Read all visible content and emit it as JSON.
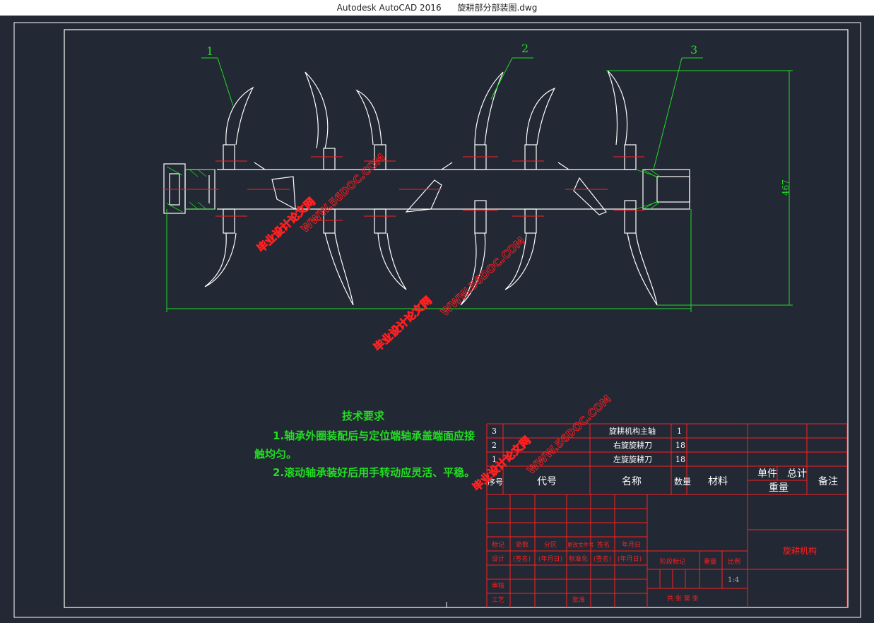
{
  "window": {
    "app": "Autodesk AutoCAD 2016",
    "file": "旋耕部分部装图.dwg"
  },
  "drawing": {
    "balloons": [
      "1",
      "2",
      "3"
    ],
    "dim_height": "467",
    "tech_title": "技术要求",
    "tech_line1": "1.轴承外圈装配后与定位端轴承盖端面应接",
    "tech_line2": "触均匀。",
    "tech_line3": "2.滚动轴承装好后用手转动应灵活、平稳。",
    "watermark_url": "WWW.56DOC.COM",
    "watermark_cn": "毕业设计论文网"
  },
  "bom": {
    "rows": [
      {
        "no": "3",
        "name": "旋耕机构主轴",
        "qty": "1"
      },
      {
        "no": "2",
        "name": "右旋旋耕刀",
        "qty": "18"
      },
      {
        "no": "1",
        "name": "左旋旋耕刀",
        "qty": "18"
      }
    ],
    "header": {
      "no": "序号",
      "code": "代号",
      "name": "名称",
      "qty": "数量",
      "material": "材料",
      "unit": "单件",
      "total": "总计",
      "weight": "重量",
      "remark": "备注"
    }
  },
  "titleblock": {
    "r1": [
      "标记",
      "处数",
      "分区",
      "更改文件号",
      "签名",
      "年月日"
    ],
    "r2": [
      "设计",
      "(签名)",
      "(年月日)",
      "标准化",
      "(签名)",
      "(年月日)"
    ],
    "stage": "阶段标记",
    "weight": "重量",
    "scale": "比例",
    "scale_val": "1:4",
    "review": "审核",
    "process": "工艺",
    "approve": "批准",
    "sheets": "共  张  第  张",
    "drawing_name": "旋耕机构"
  },
  "colors": {
    "bg": "#222834",
    "white": "#ffffff",
    "red": "#ff2020",
    "green": "#22dd22"
  }
}
